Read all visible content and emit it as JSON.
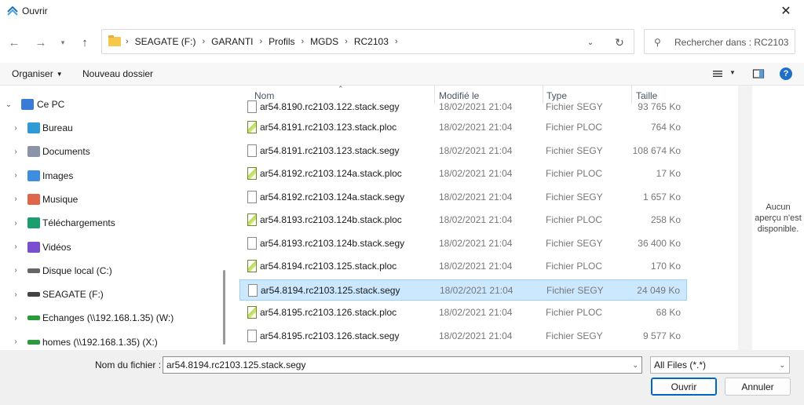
{
  "window": {
    "title": "Ouvrir"
  },
  "address": {
    "crumbs": [
      "SEAGATE (F:)",
      "GARANTI",
      "Profils",
      "MGDS",
      "RC2103"
    ]
  },
  "search": {
    "placeholder": "Rechercher dans : RC2103"
  },
  "toolbar": {
    "organize": "Organiser",
    "new_folder": "Nouveau dossier"
  },
  "sidebar": {
    "items": [
      {
        "label": "Ce PC",
        "icon": "pc-icon",
        "color": "#3a7bd5"
      },
      {
        "label": "Bureau",
        "icon": "desktop-icon",
        "color": "#2e9bd6"
      },
      {
        "label": "Documents",
        "icon": "documents-icon",
        "color": "#8a94a6"
      },
      {
        "label": "Images",
        "icon": "images-icon",
        "color": "#3d8ee0"
      },
      {
        "label": "Musique",
        "icon": "music-icon",
        "color": "#e0664a"
      },
      {
        "label": "Téléchargements",
        "icon": "download-icon",
        "color": "#1d9e6e"
      },
      {
        "label": "Vidéos",
        "icon": "videos-icon",
        "color": "#7a4fcf"
      },
      {
        "label": "Disque local (C:)",
        "icon": "drive-icon",
        "color": "#666666"
      },
      {
        "label": "SEAGATE (F:)",
        "icon": "drive-icon",
        "color": "#444444"
      },
      {
        "label": "Echanges (\\\\192.168.1.35) (W:)",
        "icon": "network-drive-icon",
        "color": "#2a9b3a"
      },
      {
        "label": "homes (\\\\192.168.1.35) (X:)",
        "icon": "network-drive-icon",
        "color": "#2a9b3a"
      }
    ]
  },
  "columns": {
    "name": "Nom",
    "modified": "Modifié le",
    "type": "Type",
    "size": "Taille"
  },
  "files": [
    {
      "name": "ar54.8190.rc2103.122.stack.segy",
      "date": "18/02/2021 21:04",
      "type": "Fichier SEGY",
      "size": "93 765 Ko",
      "kind": "segy"
    },
    {
      "name": "ar54.8191.rc2103.123.stack.ploc",
      "date": "18/02/2021 21:04",
      "type": "Fichier PLOC",
      "size": "764 Ko",
      "kind": "ploc"
    },
    {
      "name": "ar54.8191.rc2103.123.stack.segy",
      "date": "18/02/2021 21:04",
      "type": "Fichier SEGY",
      "size": "108 674 Ko",
      "kind": "segy"
    },
    {
      "name": "ar54.8192.rc2103.124a.stack.ploc",
      "date": "18/02/2021 21:04",
      "type": "Fichier PLOC",
      "size": "17 Ko",
      "kind": "ploc"
    },
    {
      "name": "ar54.8192.rc2103.124a.stack.segy",
      "date": "18/02/2021 21:04",
      "type": "Fichier SEGY",
      "size": "1 657 Ko",
      "kind": "segy"
    },
    {
      "name": "ar54.8193.rc2103.124b.stack.ploc",
      "date": "18/02/2021 21:04",
      "type": "Fichier PLOC",
      "size": "258 Ko",
      "kind": "ploc"
    },
    {
      "name": "ar54.8193.rc2103.124b.stack.segy",
      "date": "18/02/2021 21:04",
      "type": "Fichier SEGY",
      "size": "36 400 Ko",
      "kind": "segy"
    },
    {
      "name": "ar54.8194.rc2103.125.stack.ploc",
      "date": "18/02/2021 21:04",
      "type": "Fichier PLOC",
      "size": "170 Ko",
      "kind": "ploc"
    },
    {
      "name": "ar54.8194.rc2103.125.stack.segy",
      "date": "18/02/2021 21:04",
      "type": "Fichier SEGY",
      "size": "24 049 Ko",
      "kind": "segy",
      "selected": true
    },
    {
      "name": "ar54.8195.rc2103.126.stack.ploc",
      "date": "18/02/2021 21:04",
      "type": "Fichier PLOC",
      "size": "68 Ko",
      "kind": "ploc"
    },
    {
      "name": "ar54.8195.rc2103.126.stack.segy",
      "date": "18/02/2021 21:04",
      "type": "Fichier SEGY",
      "size": "9 577 Ko",
      "kind": "segy"
    }
  ],
  "preview": {
    "text": "Aucun aperçu n'est disponible."
  },
  "footer": {
    "filename_label": "Nom du fichier :",
    "filename_value": "ar54.8194.rc2103.125.stack.segy",
    "filter_value": "All Files (*.*)",
    "open_label": "Ouvrir",
    "cancel_label": "Annuler"
  }
}
